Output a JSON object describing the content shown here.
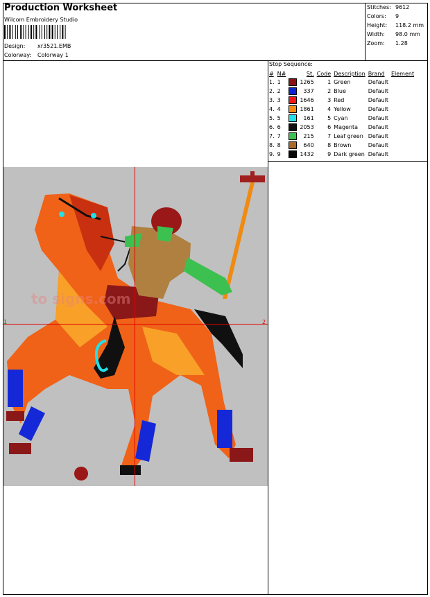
{
  "header": {
    "title": "Production Worksheet",
    "vendor": "Wilcom  Embroidery Studio",
    "design_label": "Design:",
    "design_value": "xr3521.EMB",
    "colorway_label": "Colorway:",
    "colorway_value": "Colorway 1"
  },
  "stats": {
    "stitches_label": "Stitches:",
    "stitches_value": "9612",
    "colors_label": "Colors:",
    "colors_value": "9",
    "height_label": "Height:",
    "height_value": "118.2 mm",
    "width_label": "Width:",
    "width_value": "98.0 mm",
    "zoom_label": "Zoom:",
    "zoom_value": "1.28"
  },
  "sequence": {
    "title": "Stop Sequence:",
    "headers": [
      "#",
      "N#",
      "St.",
      "Code",
      "Description",
      "Brand",
      "Element"
    ],
    "rows": [
      {
        "n": "1.",
        "nn": "1",
        "color": "#8b1010",
        "st": "1265",
        "code": "1",
        "desc": "Green",
        "brand": "Default"
      },
      {
        "n": "2.",
        "nn": "2",
        "color": "#0a24d6",
        "st": "337",
        "code": "2",
        "desc": "Blue",
        "brand": "Default"
      },
      {
        "n": "3.",
        "nn": "3",
        "color": "#f01818",
        "st": "1646",
        "code": "3",
        "desc": "Red",
        "brand": "Default"
      },
      {
        "n": "4.",
        "nn": "4",
        "color": "#f88a10",
        "st": "1861",
        "code": "4",
        "desc": "Yellow",
        "brand": "Default"
      },
      {
        "n": "5.",
        "nn": "5",
        "color": "#22e0e8",
        "st": "161",
        "code": "5",
        "desc": "Cyan",
        "brand": "Default"
      },
      {
        "n": "6.",
        "nn": "6",
        "color": "#101010",
        "st": "2053",
        "code": "6",
        "desc": "Magenta",
        "brand": "Default"
      },
      {
        "n": "7.",
        "nn": "7",
        "color": "#3cc050",
        "st": "215",
        "code": "7",
        "desc": "Leaf green",
        "brand": "Default"
      },
      {
        "n": "8.",
        "nn": "8",
        "color": "#a86a2a",
        "st": "640",
        "code": "8",
        "desc": "Brown",
        "brand": "Default"
      },
      {
        "n": "9.",
        "nn": "9",
        "color": "#080808",
        "st": "1432",
        "code": "9",
        "desc": "Dark green",
        "brand": "Default"
      }
    ]
  },
  "design": {
    "axis_left_label": "1",
    "axis_right_label": "2",
    "watermark": "to             signs.com"
  }
}
